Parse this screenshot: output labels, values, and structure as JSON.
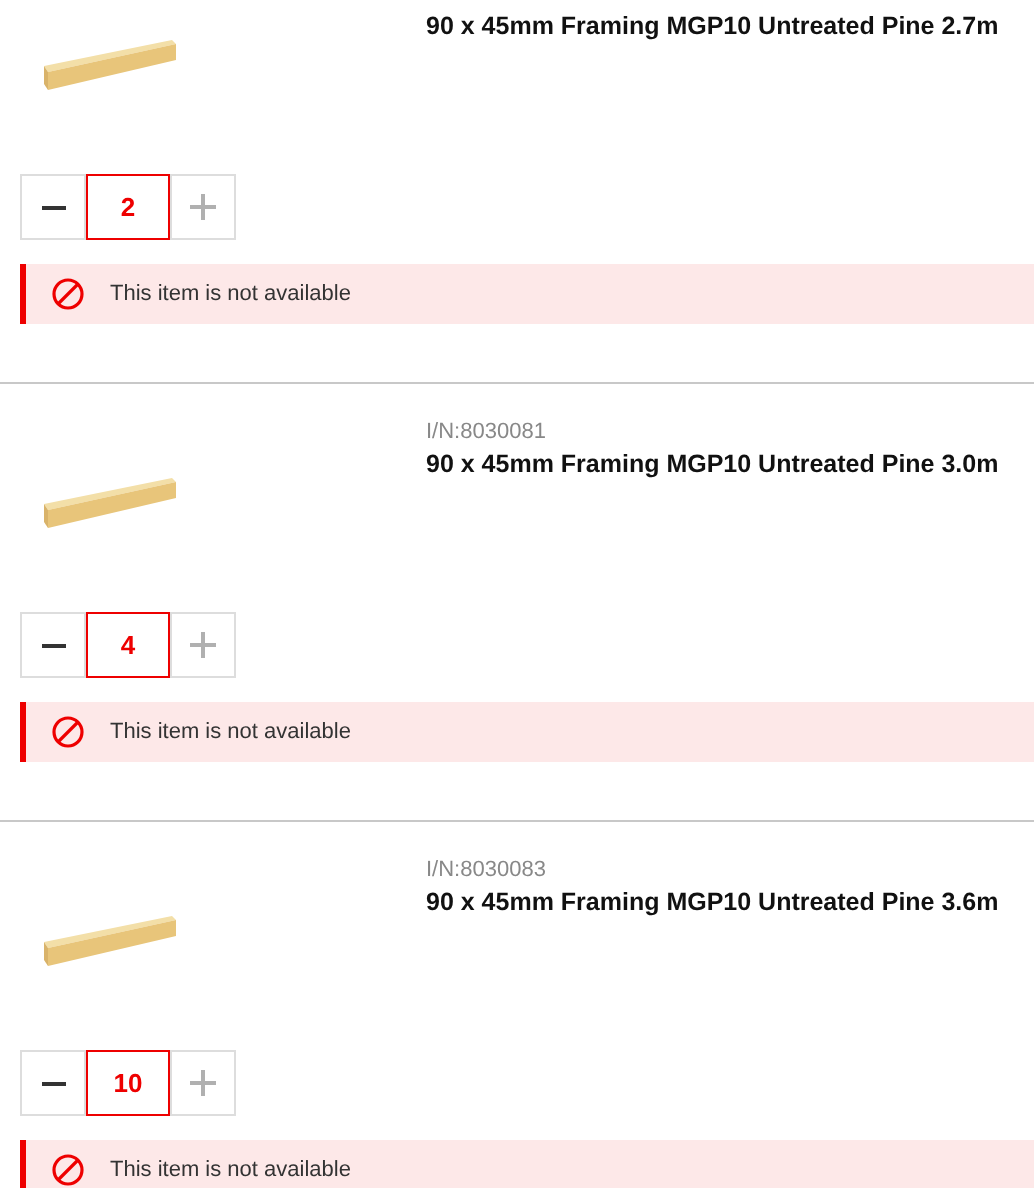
{
  "items": [
    {
      "title": "90 x 45mm Framing MGP10 Untreated Pine 2.7m",
      "quantity": "2",
      "increase_disabled": true,
      "alert": "This item is not available"
    },
    {
      "item_number": "I/N:8030081",
      "title": "90 x 45mm Framing MGP10 Untreated Pine 3.0m",
      "quantity": "4",
      "increase_disabled": true,
      "alert": "This item is not available"
    },
    {
      "item_number": "I/N:8030083",
      "title": "90 x 45mm Framing MGP10 Untreated Pine 3.6m",
      "quantity": "10",
      "increase_disabled": true,
      "alert": "This item is not available"
    }
  ]
}
